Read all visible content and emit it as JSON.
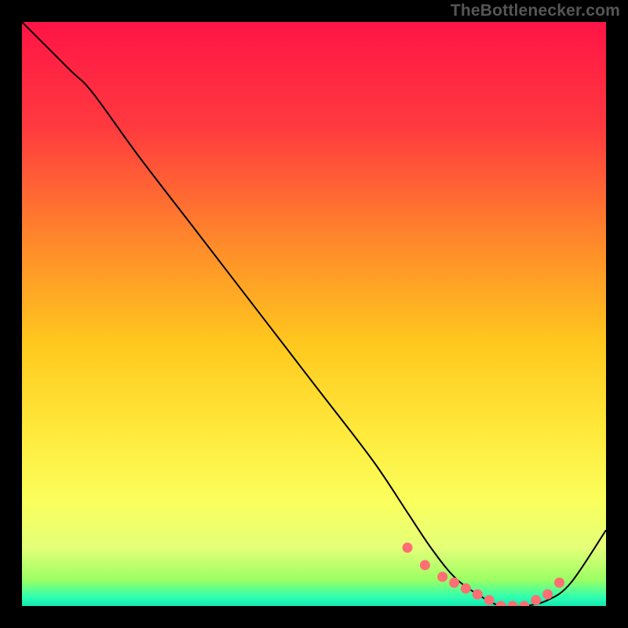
{
  "attribution": "TheBottlenecker.com",
  "colors": {
    "gradient_stops": [
      {
        "offset": 0.0,
        "color": "#ff1446"
      },
      {
        "offset": 0.18,
        "color": "#ff3a3f"
      },
      {
        "offset": 0.38,
        "color": "#ff8a2a"
      },
      {
        "offset": 0.55,
        "color": "#ffc81e"
      },
      {
        "offset": 0.7,
        "color": "#ffe93b"
      },
      {
        "offset": 0.82,
        "color": "#fbff5c"
      },
      {
        "offset": 0.9,
        "color": "#e4ff78"
      },
      {
        "offset": 0.955,
        "color": "#9cff64"
      },
      {
        "offset": 0.985,
        "color": "#2dffb0"
      },
      {
        "offset": 1.0,
        "color": "#12e8b3"
      }
    ],
    "curve_stroke": "#000000",
    "marker_fill": "#ff6e73",
    "marker_stroke": "#ff6e73"
  },
  "chart_data": {
    "type": "line",
    "title": "",
    "xlabel": "",
    "ylabel": "",
    "xlim": [
      0,
      100
    ],
    "ylim": [
      0,
      100
    ],
    "grid": false,
    "series": [
      {
        "name": "bottleneck-curve",
        "x": [
          0,
          8,
          12,
          20,
          30,
          40,
          50,
          60,
          66,
          70,
          74,
          78,
          82,
          86,
          90,
          94,
          100
        ],
        "y": [
          100,
          92,
          88,
          77,
          64,
          51,
          38,
          25,
          16,
          10,
          5,
          2,
          0,
          0,
          1,
          4,
          13
        ]
      }
    ],
    "markers": {
      "name": "optimal-band",
      "x": [
        66,
        69,
        72,
        74,
        76,
        78,
        80,
        82,
        84,
        86,
        88,
        90,
        92
      ],
      "y": [
        10,
        7,
        5,
        4,
        3,
        2,
        1,
        0,
        0,
        0,
        1,
        2,
        4
      ]
    }
  }
}
